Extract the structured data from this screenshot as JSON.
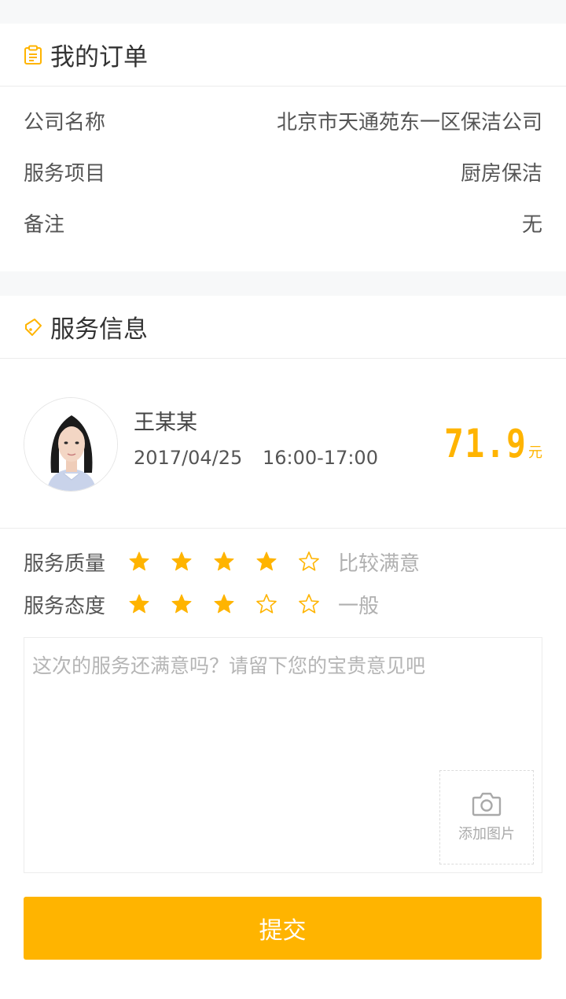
{
  "order": {
    "title": "我的订单",
    "rows": [
      {
        "label": "公司名称",
        "value": "北京市天通苑东一区保洁公司"
      },
      {
        "label": "服务项目",
        "value": "厨房保洁"
      },
      {
        "label": "备注",
        "value": "无"
      }
    ]
  },
  "service": {
    "title": "服务信息",
    "name": "王某某",
    "date": "2017/04/25",
    "time": "16:00-17:00",
    "price": "71.9",
    "unit": "元"
  },
  "ratings": [
    {
      "label": "服务质量",
      "stars": 4,
      "max": 5,
      "text": "比较满意"
    },
    {
      "label": "服务态度",
      "stars": 3,
      "max": 5,
      "text": "一般"
    }
  ],
  "comment": {
    "placeholder": "这次的服务还满意吗？请留下您的宝贵意见吧",
    "value": "",
    "add_photo_label": "添加图片"
  },
  "submit_label": "提交",
  "colors": {
    "accent": "#ffb400",
    "background": "#f7f8f9"
  }
}
